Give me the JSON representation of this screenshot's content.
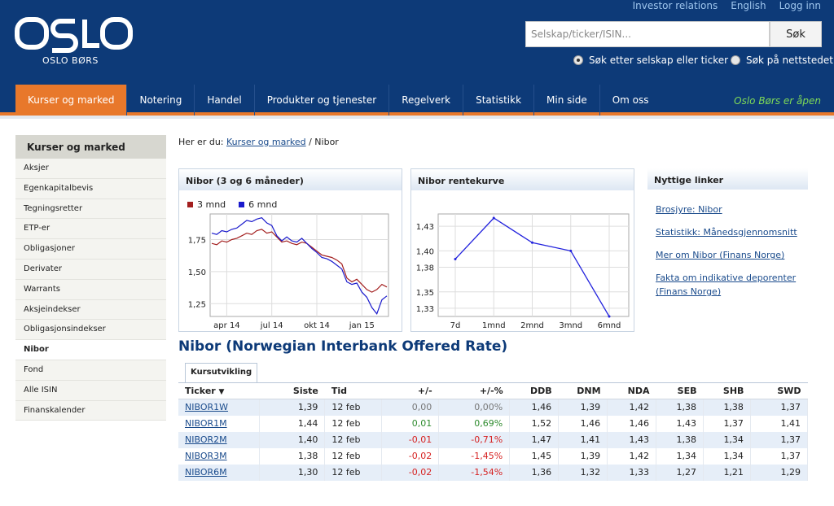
{
  "header": {
    "logo_text": "OSLO",
    "logo_sub": "OSLO BØRS",
    "top_links": [
      "Investor relations",
      "English",
      "Logg inn"
    ],
    "search_placeholder": "Selskap/ticker/ISIN...",
    "search_button": "Søk",
    "radio_company": "Søk etter selskap eller ticker",
    "radio_site": "Søk på nettstedet"
  },
  "nav": {
    "items": [
      "Kurser og marked",
      "Notering",
      "Handel",
      "Produkter og tjenester",
      "Regelverk",
      "Statistikk",
      "Min side",
      "Om oss"
    ],
    "status": "Oslo Børs er åpen"
  },
  "sidebar": {
    "title": "Kurser og marked",
    "items": [
      "Aksjer",
      "Egenkapitalbevis",
      "Tegningsretter",
      "ETP-er",
      "Obligasjoner",
      "Derivater",
      "Warrants",
      "Aksjeindekser",
      "Obligasjonsindekser",
      "Nibor",
      "Fond",
      "Alle ISIN",
      "Finanskalender"
    ]
  },
  "breadcrumb": {
    "prefix": "Her er du:",
    "link": "Kurser og marked",
    "current": "/ Nibor"
  },
  "links": {
    "title": "Nyttige linker",
    "items": [
      "Brosjyre: Nibor",
      "Statistikk: Månedsgjennomsnitt",
      "Mer om Nibor (Finans Norge)",
      "Fakta om indikative deporenter (Finans Norge)"
    ]
  },
  "section_title": "Nibor (Norwegian Interbank Offered Rate)",
  "tab_label": "Kursutvikling",
  "table": {
    "headers": [
      "Ticker",
      "Siste",
      "Tid",
      "+/-",
      "+/-%",
      "DDB",
      "DNM",
      "NDA",
      "SEB",
      "SHB",
      "SWD"
    ],
    "rows": [
      [
        "NIBOR1W",
        "1,39",
        "12 feb",
        "0,00",
        "0,00%",
        "1,46",
        "1,39",
        "1,42",
        "1,38",
        "1,38",
        "1,37"
      ],
      [
        "NIBOR1M",
        "1,44",
        "12 feb",
        "0,01",
        "0,69%",
        "1,52",
        "1,46",
        "1,46",
        "1,43",
        "1,37",
        "1,41"
      ],
      [
        "NIBOR2M",
        "1,40",
        "12 feb",
        "-0,01",
        "-0,71%",
        "1,47",
        "1,41",
        "1,43",
        "1,38",
        "1,34",
        "1,37"
      ],
      [
        "NIBOR3M",
        "1,38",
        "12 feb",
        "-0,02",
        "-1,45%",
        "1,45",
        "1,39",
        "1,42",
        "1,34",
        "1,34",
        "1,37"
      ],
      [
        "NIBOR6M",
        "1,30",
        "12 feb",
        "-0,02",
        "-1,54%",
        "1,36",
        "1,32",
        "1,33",
        "1,27",
        "1,21",
        "1,29"
      ]
    ]
  },
  "colors": {
    "navy": "#0d3a78",
    "orange": "#e8782b",
    "series_3m": "#a31f1f",
    "series_6m": "#1a1acc",
    "curve": "#2222dd"
  },
  "chart_data": [
    {
      "type": "line",
      "title": "Nibor (3 og 6 måneder)",
      "x_tick_labels": [
        "apr 14",
        "jul 14",
        "okt 14",
        "jan 15"
      ],
      "y_tick_labels": [
        "1,25",
        "1,50",
        "1,75"
      ],
      "ylim": [
        1.15,
        1.95
      ],
      "grid": true,
      "legend": "top-left",
      "series": [
        {
          "name": "3 mnd",
          "color": "#a31f1f",
          "values": [
            1.72,
            1.71,
            1.74,
            1.73,
            1.75,
            1.76,
            1.78,
            1.8,
            1.79,
            1.82,
            1.83,
            1.8,
            1.81,
            1.77,
            1.73,
            1.74,
            1.72,
            1.71,
            1.73,
            1.72,
            1.69,
            1.66,
            1.63,
            1.62,
            1.61,
            1.59,
            1.56,
            1.45,
            1.42,
            1.44,
            1.4,
            1.36,
            1.34,
            1.36,
            1.4,
            1.38
          ]
        },
        {
          "name": "6 mnd",
          "color": "#1a1acc",
          "values": [
            1.8,
            1.79,
            1.82,
            1.81,
            1.83,
            1.84,
            1.87,
            1.9,
            1.89,
            1.91,
            1.92,
            1.88,
            1.86,
            1.78,
            1.74,
            1.77,
            1.74,
            1.73,
            1.76,
            1.72,
            1.68,
            1.65,
            1.61,
            1.6,
            1.58,
            1.55,
            1.52,
            1.42,
            1.4,
            1.41,
            1.34,
            1.3,
            1.22,
            1.17,
            1.28,
            1.31
          ]
        }
      ]
    },
    {
      "type": "line",
      "title": "Nibor rentekurve",
      "categories": [
        "7d",
        "1mnd",
        "2mnd",
        "3mnd",
        "6mnd"
      ],
      "values": [
        1.39,
        1.44,
        1.41,
        1.4,
        1.32
      ],
      "y_tick_labels": [
        "1,33",
        "1,35",
        "1,38",
        "1,40",
        "1,43"
      ],
      "ylim": [
        1.32,
        1.445
      ],
      "grid": true,
      "color": "#2222dd"
    }
  ]
}
